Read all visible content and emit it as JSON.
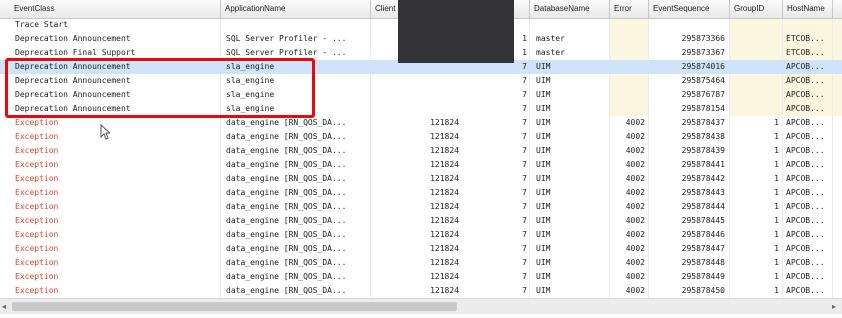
{
  "header": {
    "columns": [
      "EventClass",
      "ApplicationName",
      "Client",
      "",
      "DatabaseName",
      "Error",
      "EventSequence",
      "GroupID",
      "HostName"
    ]
  },
  "rows": [
    {
      "event_class": "Trace Start",
      "application": "",
      "client": "",
      "dbid": "",
      "database": "",
      "error": "",
      "sequence": "",
      "group": "",
      "host": "",
      "red": false,
      "selected": false
    },
    {
      "event_class": "Deprecation Announcement",
      "application": "SQL Server Profiler - ...",
      "client": "",
      "dbid": "1",
      "database": "master",
      "error": "",
      "sequence": "295873366",
      "group": "",
      "host": "ETCOB...",
      "red": false,
      "selected": false
    },
    {
      "event_class": "Deprecation Final Support",
      "application": "SQL Server Profiler - ...",
      "client": "",
      "dbid": "1",
      "database": "master",
      "error": "",
      "sequence": "295873367",
      "group": "",
      "host": "ETCOB...",
      "red": false,
      "selected": false
    },
    {
      "event_class": "Deprecation Announcement",
      "application": "sla_engine",
      "client": "",
      "dbid": "7",
      "database": "UIM",
      "error": "",
      "sequence": "295874016",
      "group": "",
      "host": "APCOB...",
      "red": false,
      "selected": true
    },
    {
      "event_class": "Deprecation Announcement",
      "application": "sla_engine",
      "client": "",
      "dbid": "7",
      "database": "UIM",
      "error": "",
      "sequence": "295875464",
      "group": "",
      "host": "APCOB...",
      "red": false,
      "selected": false
    },
    {
      "event_class": "Deprecation Announcement",
      "application": "sla_engine",
      "client": "",
      "dbid": "7",
      "database": "UIM",
      "error": "",
      "sequence": "295876787",
      "group": "",
      "host": "APCOB...",
      "red": false,
      "selected": false
    },
    {
      "event_class": "Deprecation Announcement",
      "application": "sla_engine",
      "client": "",
      "dbid": "7",
      "database": "UIM",
      "error": "",
      "sequence": "295878154",
      "group": "",
      "host": "APCOB...",
      "red": false,
      "selected": false
    },
    {
      "event_class": "Exception",
      "application": "data_engine [RN_QOS_DA...",
      "client": "121824",
      "dbid": "7",
      "database": "UIM",
      "error": "4002",
      "sequence": "295878437",
      "group": "1",
      "host": "APCOB...",
      "red": true,
      "selected": false
    },
    {
      "event_class": "Exception",
      "application": "data_engine [RN_QOS_DA...",
      "client": "121824",
      "dbid": "7",
      "database": "UIM",
      "error": "4002",
      "sequence": "295878438",
      "group": "1",
      "host": "APCOB...",
      "red": true,
      "selected": false
    },
    {
      "event_class": "Exception",
      "application": "data_engine [RN_QOS_DA...",
      "client": "121824",
      "dbid": "7",
      "database": "UIM",
      "error": "4002",
      "sequence": "295878439",
      "group": "1",
      "host": "APCOB...",
      "red": true,
      "selected": false
    },
    {
      "event_class": "Exception",
      "application": "data_engine [RN_QOS_DA...",
      "client": "121824",
      "dbid": "7",
      "database": "UIM",
      "error": "4002",
      "sequence": "295878441",
      "group": "1",
      "host": "APCOB...",
      "red": true,
      "selected": false
    },
    {
      "event_class": "Exception",
      "application": "data_engine [RN_QOS_DA...",
      "client": "121824",
      "dbid": "7",
      "database": "UIM",
      "error": "4002",
      "sequence": "295878442",
      "group": "1",
      "host": "APCOB...",
      "red": true,
      "selected": false
    },
    {
      "event_class": "Exception",
      "application": "data_engine [RN_QOS_DA...",
      "client": "121824",
      "dbid": "7",
      "database": "UIM",
      "error": "4002",
      "sequence": "295878443",
      "group": "1",
      "host": "APCOB...",
      "red": true,
      "selected": false
    },
    {
      "event_class": "Exception",
      "application": "data_engine [RN_QOS_DA...",
      "client": "121824",
      "dbid": "7",
      "database": "UIM",
      "error": "4002",
      "sequence": "295878444",
      "group": "1",
      "host": "APCOB...",
      "red": true,
      "selected": false
    },
    {
      "event_class": "Exception",
      "application": "data_engine [RN_QOS_DA...",
      "client": "121824",
      "dbid": "7",
      "database": "UIM",
      "error": "4002",
      "sequence": "295878445",
      "group": "1",
      "host": "APCOB...",
      "red": true,
      "selected": false
    },
    {
      "event_class": "Exception",
      "application": "data_engine [RN_QOS_DA...",
      "client": "121824",
      "dbid": "7",
      "database": "UIM",
      "error": "4002",
      "sequence": "295878446",
      "group": "1",
      "host": "APCOB...",
      "red": true,
      "selected": false
    },
    {
      "event_class": "Exception",
      "application": "data_engine [RN_QOS_DA...",
      "client": "121824",
      "dbid": "7",
      "database": "UIM",
      "error": "4002",
      "sequence": "295878447",
      "group": "1",
      "host": "APCOB...",
      "red": true,
      "selected": false
    },
    {
      "event_class": "Exception",
      "application": "data_engine [RN_QOS_DA...",
      "client": "121824",
      "dbid": "7",
      "database": "UIM",
      "error": "4002",
      "sequence": "295878448",
      "group": "1",
      "host": "APCOB...",
      "red": true,
      "selected": false
    },
    {
      "event_class": "Exception",
      "application": "data_engine [RN_QOS_DA...",
      "client": "121824",
      "dbid": "7",
      "database": "UIM",
      "error": "4002",
      "sequence": "295878449",
      "group": "1",
      "host": "APCOB...",
      "red": true,
      "selected": false
    },
    {
      "event_class": "Exception",
      "application": "data_engine [RN_QOS_DA...",
      "client": "121824",
      "dbid": "7",
      "database": "UIM",
      "error": "4002",
      "sequence": "295878450",
      "group": "1",
      "host": "APCOB...",
      "red": true,
      "selected": false
    }
  ],
  "scrollbar": {
    "left_arrow": "◂",
    "right_arrow": "▸"
  },
  "icons": {
    "cursor": "mouse-pointer-icon"
  },
  "colors": {
    "exception_text": "#e0442a",
    "selection": "#cfe4fb",
    "highlight_border": "#e60a0a",
    "redaction": "#333335"
  }
}
